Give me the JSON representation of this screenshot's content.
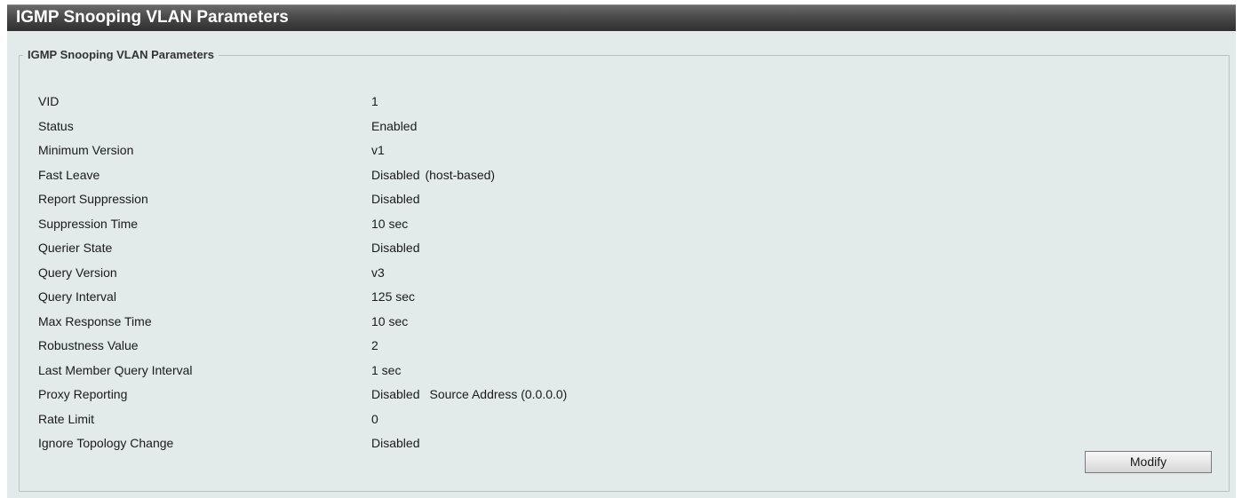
{
  "header": {
    "title": "IGMP Snooping VLAN Parameters"
  },
  "panel": {
    "legend": "IGMP Snooping VLAN Parameters",
    "rows": [
      {
        "label": "VID",
        "value": "1"
      },
      {
        "label": "Status",
        "value": "Enabled"
      },
      {
        "label": "Minimum Version",
        "value": "v1"
      },
      {
        "label": "Fast Leave",
        "value": "Disabled",
        "extra": "(host-based)"
      },
      {
        "label": "Report Suppression",
        "value": "Disabled"
      },
      {
        "label": "Suppression Time",
        "value": "10 sec"
      },
      {
        "label": "Querier State",
        "value": "Disabled"
      },
      {
        "label": "Query Version",
        "value": "v3"
      },
      {
        "label": "Query Interval",
        "value": "125 sec"
      },
      {
        "label": "Max Response Time",
        "value": "10 sec"
      },
      {
        "label": "Robustness Value",
        "value": "2"
      },
      {
        "label": "Last Member Query Interval",
        "value": "1 sec"
      },
      {
        "label": "Proxy Reporting",
        "value": "Disabled",
        "extra": "Source Address (0.0.0.0)"
      },
      {
        "label": "Rate Limit",
        "value": "0"
      },
      {
        "label": "Ignore Topology Change",
        "value": "Disabled"
      }
    ],
    "modify_label": "Modify"
  },
  "colors": {
    "title_bar": "#3f3f3f",
    "panel_background": "#e3ebea",
    "fieldset_border": "#b9c2c1"
  }
}
